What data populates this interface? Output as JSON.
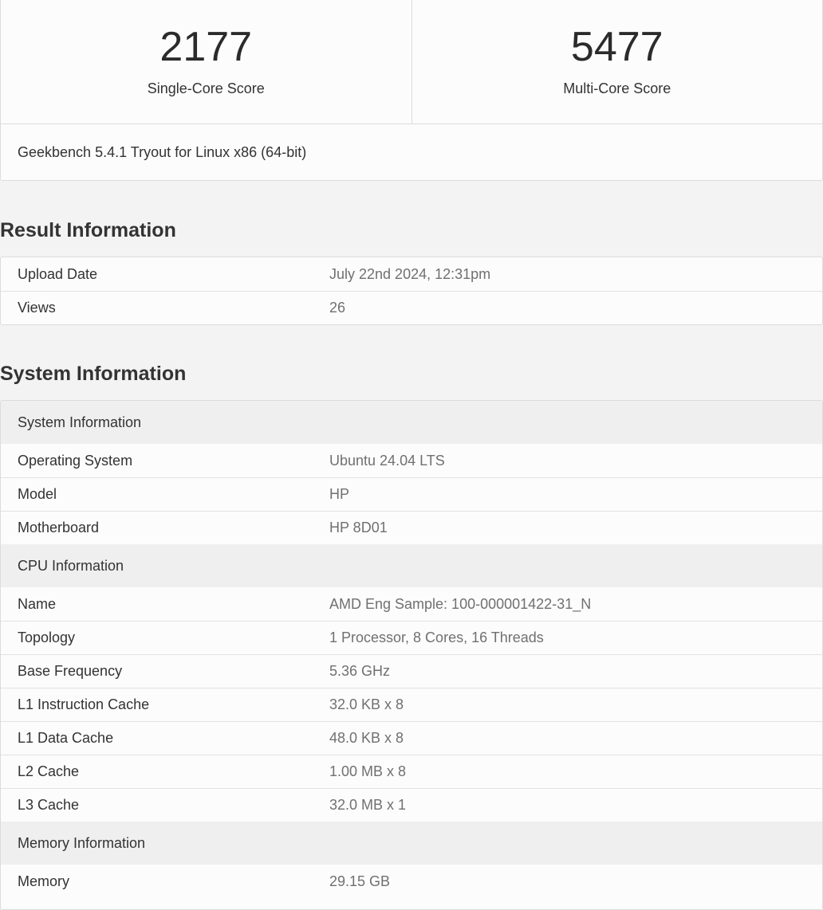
{
  "scores": {
    "single_core_value": "2177",
    "single_core_label": "Single-Core Score",
    "multi_core_value": "5477",
    "multi_core_label": "Multi-Core Score",
    "version": "Geekbench 5.4.1 Tryout for Linux x86 (64-bit)"
  },
  "result_information": {
    "heading": "Result Information",
    "rows": [
      {
        "key": "Upload Date",
        "value": "July 22nd 2024, 12:31pm"
      },
      {
        "key": "Views",
        "value": "26"
      }
    ]
  },
  "system_information": {
    "heading": "System Information",
    "groups": [
      {
        "title": "System Information",
        "rows": [
          {
            "key": "Operating System",
            "value": "Ubuntu 24.04 LTS"
          },
          {
            "key": "Model",
            "value": "HP"
          },
          {
            "key": "Motherboard",
            "value": "HP 8D01"
          }
        ]
      },
      {
        "title": "CPU Information",
        "rows": [
          {
            "key": "Name",
            "value": "AMD Eng Sample: 100-000001422-31_N"
          },
          {
            "key": "Topology",
            "value": "1 Processor, 8 Cores, 16 Threads"
          },
          {
            "key": "Base Frequency",
            "value": "5.36 GHz"
          },
          {
            "key": "L1 Instruction Cache",
            "value": "32.0 KB x 8"
          },
          {
            "key": "L1 Data Cache",
            "value": "48.0 KB x 8"
          },
          {
            "key": "L2 Cache",
            "value": "1.00 MB x 8"
          },
          {
            "key": "L3 Cache",
            "value": "32.0 MB x 1"
          }
        ]
      },
      {
        "title": "Memory Information",
        "rows": [
          {
            "key": "Memory",
            "value": "29.15 GB"
          }
        ]
      }
    ]
  }
}
